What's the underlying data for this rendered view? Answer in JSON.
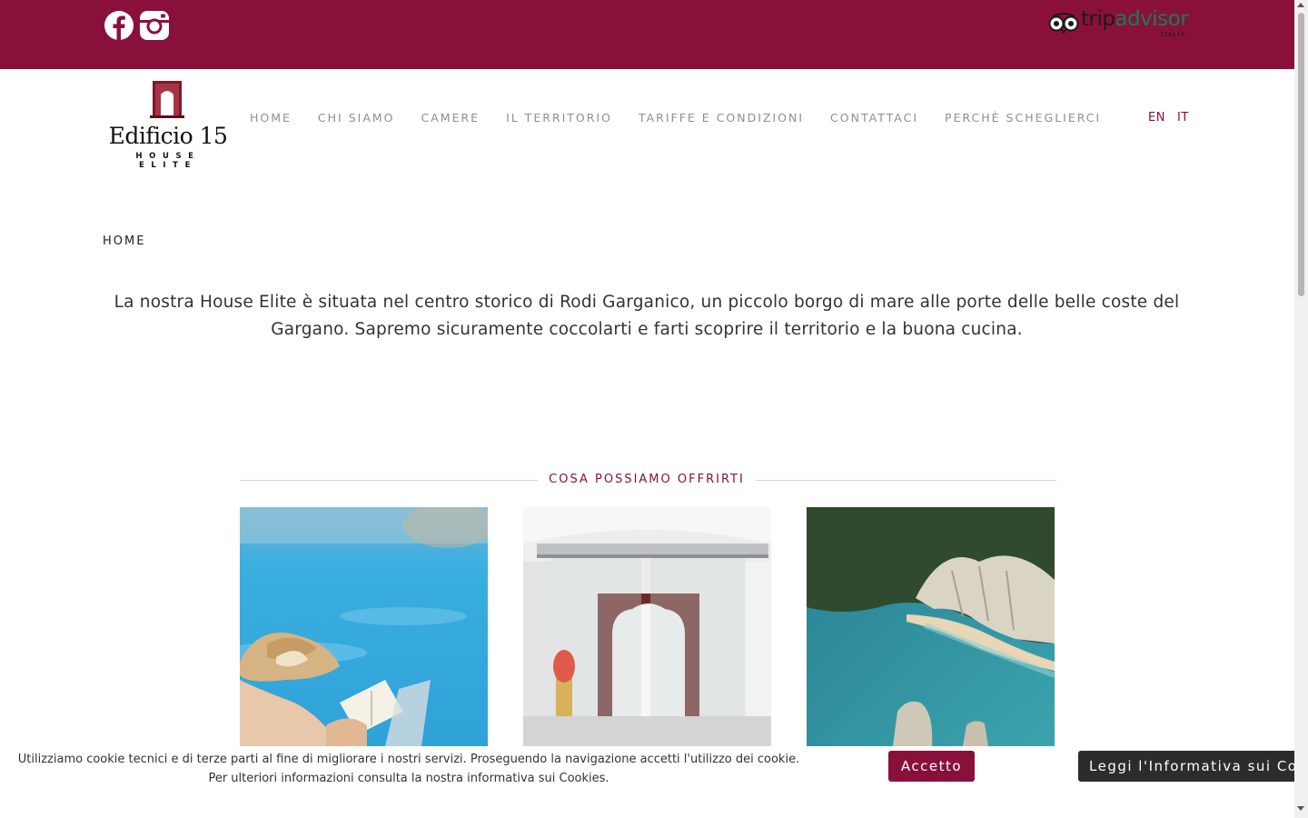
{
  "brand": {
    "name": "Edificio 15",
    "tagline": "HOUSE ELITE",
    "primary_color": "#8a103c"
  },
  "topbar": {
    "social": [
      {
        "name": "facebook-icon"
      },
      {
        "name": "instagram-icon"
      }
    ],
    "tripadvisor": {
      "word_trip": "trip",
      "word_advisor": "advisor",
      "country": "ITALIA"
    }
  },
  "nav": {
    "items": [
      {
        "label": "HOME"
      },
      {
        "label": "CHI SIAMO"
      },
      {
        "label": "CAMERE"
      },
      {
        "label": "IL TERRITORIO"
      },
      {
        "label": "TARIFFE E CONDIZIONI"
      },
      {
        "label": "CONTATTACI"
      },
      {
        "label": "PERCHÈ SCHEGLIERCI"
      }
    ],
    "languages": [
      "EN",
      "IT"
    ]
  },
  "breadcrumb": "HOME",
  "intro": "La nostra House Elite è situata nel centro storico di Rodi Garganico, un piccolo borgo di mare alle porte delle belle coste del Gargano. Sapremo sicuramente coccolarti e farti scoprire il territorio e la buona cucina.",
  "offers": {
    "title": "COSA POSSIAMO OFFRIRTI",
    "cards": [
      {
        "image": "woman-reading-by-pool"
      },
      {
        "image": "glass-entrance-door"
      },
      {
        "image": "gargano-coast-beach"
      }
    ]
  },
  "cookie_banner": {
    "line1": "Utilizziamo cookie tecnici e di terze parti al fine di migliorare i nostri servizi. Proseguendo la navigazione accetti l'utilizzo dei cookie.",
    "line2": "Per ulteriori informazioni consulta la nostra informativa sui Cookies.",
    "accept_label": "Accetto",
    "policy_label": "Leggi l'Informativa sui Cookies"
  }
}
